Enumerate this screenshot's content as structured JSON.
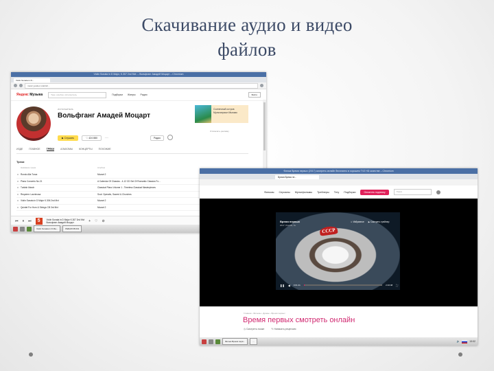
{
  "slide": {
    "title_line1": "Скачивание аудио и видео",
    "title_line2": "файлов"
  },
  "shot1": {
    "window_title": "Violin Sonata in D Major, K.307 2nd Mvt. – Вольфганг Амадей Моцарт – Chromium",
    "tab_label": "Violin Sonata in D...",
    "url": "music.yandex.ru/artist/...",
    "logo_brand": "Яндекс",
    "logo_product": "Музыка",
    "search_placeholder": "Трек, альбом, исполнитель",
    "nav": [
      "Подборки",
      "Жанры",
      "Радио"
    ],
    "login_label": "Войти",
    "artist_kind": "ИСПОЛНИТЕЛЬ",
    "artist_name": "Вольфганг Амадей Моцарт",
    "listen_label": "Слушать",
    "likes_label": "424 880",
    "radio_label": "Радио",
    "ad_text": [
      "Солнечный остров",
      "Мультсериал Мьюзик"
    ],
    "ad_close": "Отключить рекламу",
    "subtabs": [
      "ИЗДЕ",
      "ГЛАВНОЕ",
      "ТРЕКИ",
      "АЛЬБОМЫ",
      "КОНЦЕРТЫ",
      "ПОХОЖИЕ"
    ],
    "active_subtab": "ТРЕКИ",
    "section_title": "Треки",
    "col_track": "Название трека",
    "col_album": "Альбом",
    "tracks": [
      {
        "title": "Rondo Alla Turca",
        "album": "Mozart 2",
        "time": "3:35"
      },
      {
        "title": "Piano Concerto No.21",
        "album": "A Calendar Of Classics - 4-12 CD Set Of Romantic Classics Fo...",
        "time": "6:50"
      },
      {
        "title": "Turkish March",
        "album": "Classical Piano Volume 1 - Timeless Classical Masterpieces",
        "time": "3:31"
      },
      {
        "title": "Requiem: Lacrimosa",
        "album": "Soul: Operatic, Sacred & Churches",
        "time": "3:07"
      },
      {
        "title": "Violin Sonata in D Major K.306 2nd Mvt",
        "album": "Mozart 2",
        "time": "5:03"
      },
      {
        "title": "Quintet For Horn & Strings Cl5 3rd Mvt",
        "album": "Mozart 2",
        "time": "3:22"
      }
    ],
    "now_playing_title": "Violin Sonata in D Major K.307 2nd Mvt",
    "now_playing_artist": "Вольфганг Амадей Моцарт",
    "cover_letter": "5",
    "task_buttons": [
      "Violin Sonata in D Ma...",
      "РЕБАЛОВ 001"
    ],
    "clock": "13:13"
  },
  "shot2": {
    "window_title": "Фильм Время первых (2017) смотреть онлайн бесплатно в хорошем TVZ HD качестве – Chromium",
    "tab_label": "Время Время пе...",
    "nav": [
      "Фильмы",
      "Сериалы",
      "Мультфильмы",
      "Трейлеры",
      "Тегу",
      "Подборки"
    ],
    "subscribe_label": "Оплатить подписку",
    "search_placeholder": "Поиск",
    "video_title": "Время первых",
    "video_meta": "2017, Россия, 6+",
    "video_btn_fav": "Избранное",
    "video_btn_trailer": "Смотреть трейлер",
    "helmet_text": "СССР",
    "time_current": "0:01:41",
    "time_total": "2:16:48",
    "progress": 0.01,
    "breadcrumb": "Главная › Фильмы › Драмы › Время первых",
    "page_title": "Время первых смотреть онлайн",
    "links": [
      "Смотреть позже",
      "Написать рецензию"
    ],
    "task_buttons": [
      "Фильм Время перв...",
      "..."
    ],
    "clock": "13:02"
  }
}
